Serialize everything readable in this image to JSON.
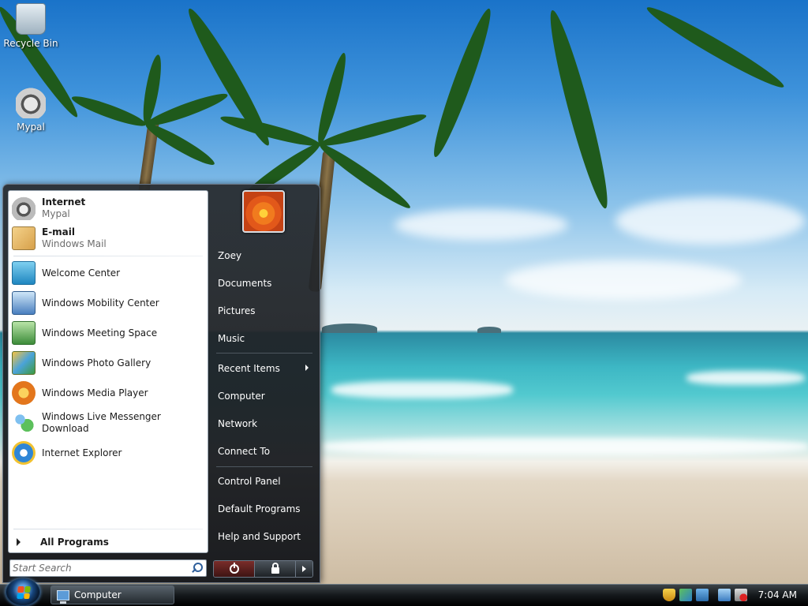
{
  "desktop": {
    "icons": [
      {
        "label": "Recycle Bin",
        "icon": "recycle-bin-icon"
      },
      {
        "label": "Mypal",
        "icon": "mypal-raccoon-icon"
      }
    ]
  },
  "start_menu": {
    "pinned": [
      {
        "title": "Internet",
        "subtitle": "Mypal",
        "icon": "mypal-raccoon-icon"
      },
      {
        "title": "E-mail",
        "subtitle": "Windows Mail",
        "icon": "windows-mail-icon"
      }
    ],
    "recent": [
      {
        "label": "Welcome Center",
        "icon": "welcome-center-icon"
      },
      {
        "label": "Windows Mobility Center",
        "icon": "mobility-center-icon"
      },
      {
        "label": "Windows Meeting Space",
        "icon": "meeting-space-icon"
      },
      {
        "label": "Windows Photo Gallery",
        "icon": "photo-gallery-icon"
      },
      {
        "label": "Windows Media Player",
        "icon": "media-player-icon"
      },
      {
        "label": "Windows Live Messenger Download",
        "icon": "messenger-icon"
      },
      {
        "label": "Internet Explorer",
        "icon": "internet-explorer-icon"
      }
    ],
    "all_programs": "All Programs",
    "search_placeholder": "Start Search",
    "right_items": {
      "user": "Zoey",
      "documents": "Documents",
      "pictures": "Pictures",
      "music": "Music",
      "recent_items": "Recent Items",
      "computer": "Computer",
      "network": "Network",
      "connect_to": "Connect To",
      "control_panel": "Control Panel",
      "default_programs": "Default Programs",
      "help_support": "Help and Support"
    }
  },
  "taskbar": {
    "task_button": "Computer",
    "clock": "7:04 AM",
    "accent": "#1d3f66"
  }
}
